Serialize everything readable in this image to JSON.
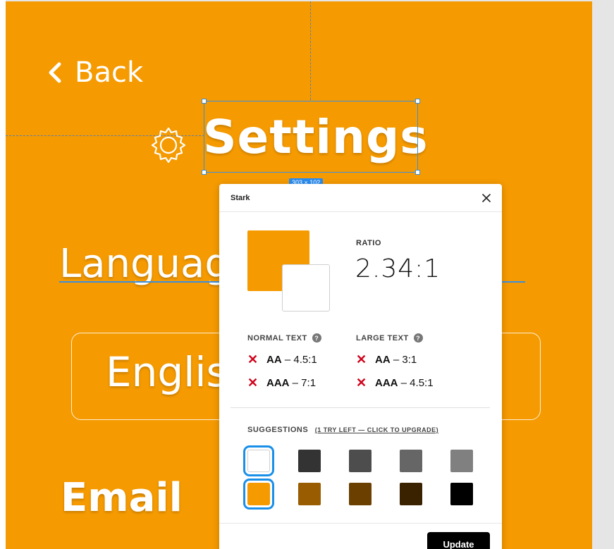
{
  "colors": {
    "frame_bg": "#f59a00",
    "selection": "#3a8fe0",
    "fail": "#d0021b"
  },
  "canvas": {
    "back_label": "Back",
    "title": "Settings",
    "size_badge": "303 × 102",
    "language_label": "Language",
    "language_value": "English",
    "email_label": "Email"
  },
  "stark": {
    "title": "Stark",
    "ratio_label": "RATIO",
    "ratio_value": "2.34:1",
    "foreground_color": "#f59a00",
    "background_color": "#ffffff",
    "normal_text": {
      "title": "NORMAL TEXT",
      "rows": [
        {
          "level": "AA",
          "value": "– 4.5:1",
          "status": "fail"
        },
        {
          "level": "AAA",
          "value": "– 7:1",
          "status": "fail"
        }
      ]
    },
    "large_text": {
      "title": "LARGE TEXT",
      "rows": [
        {
          "level": "AA",
          "value": "– 3:1",
          "status": "fail"
        },
        {
          "level": "AAA",
          "value": "– 4.5:1",
          "status": "fail"
        }
      ]
    },
    "suggestions_title": "SUGGESTIONS",
    "suggestions_upgrade": "(1 TRY LEFT — CLICK TO UPGRADE)",
    "suggestion_rows": [
      [
        "#ffffff",
        "#333333",
        "#4d4d4d",
        "#666666",
        "#808080"
      ],
      [
        "#f59a00",
        "#9a5c00",
        "#6b3f00",
        "#3a2200",
        "#000000"
      ]
    ],
    "update_label": "Update"
  }
}
